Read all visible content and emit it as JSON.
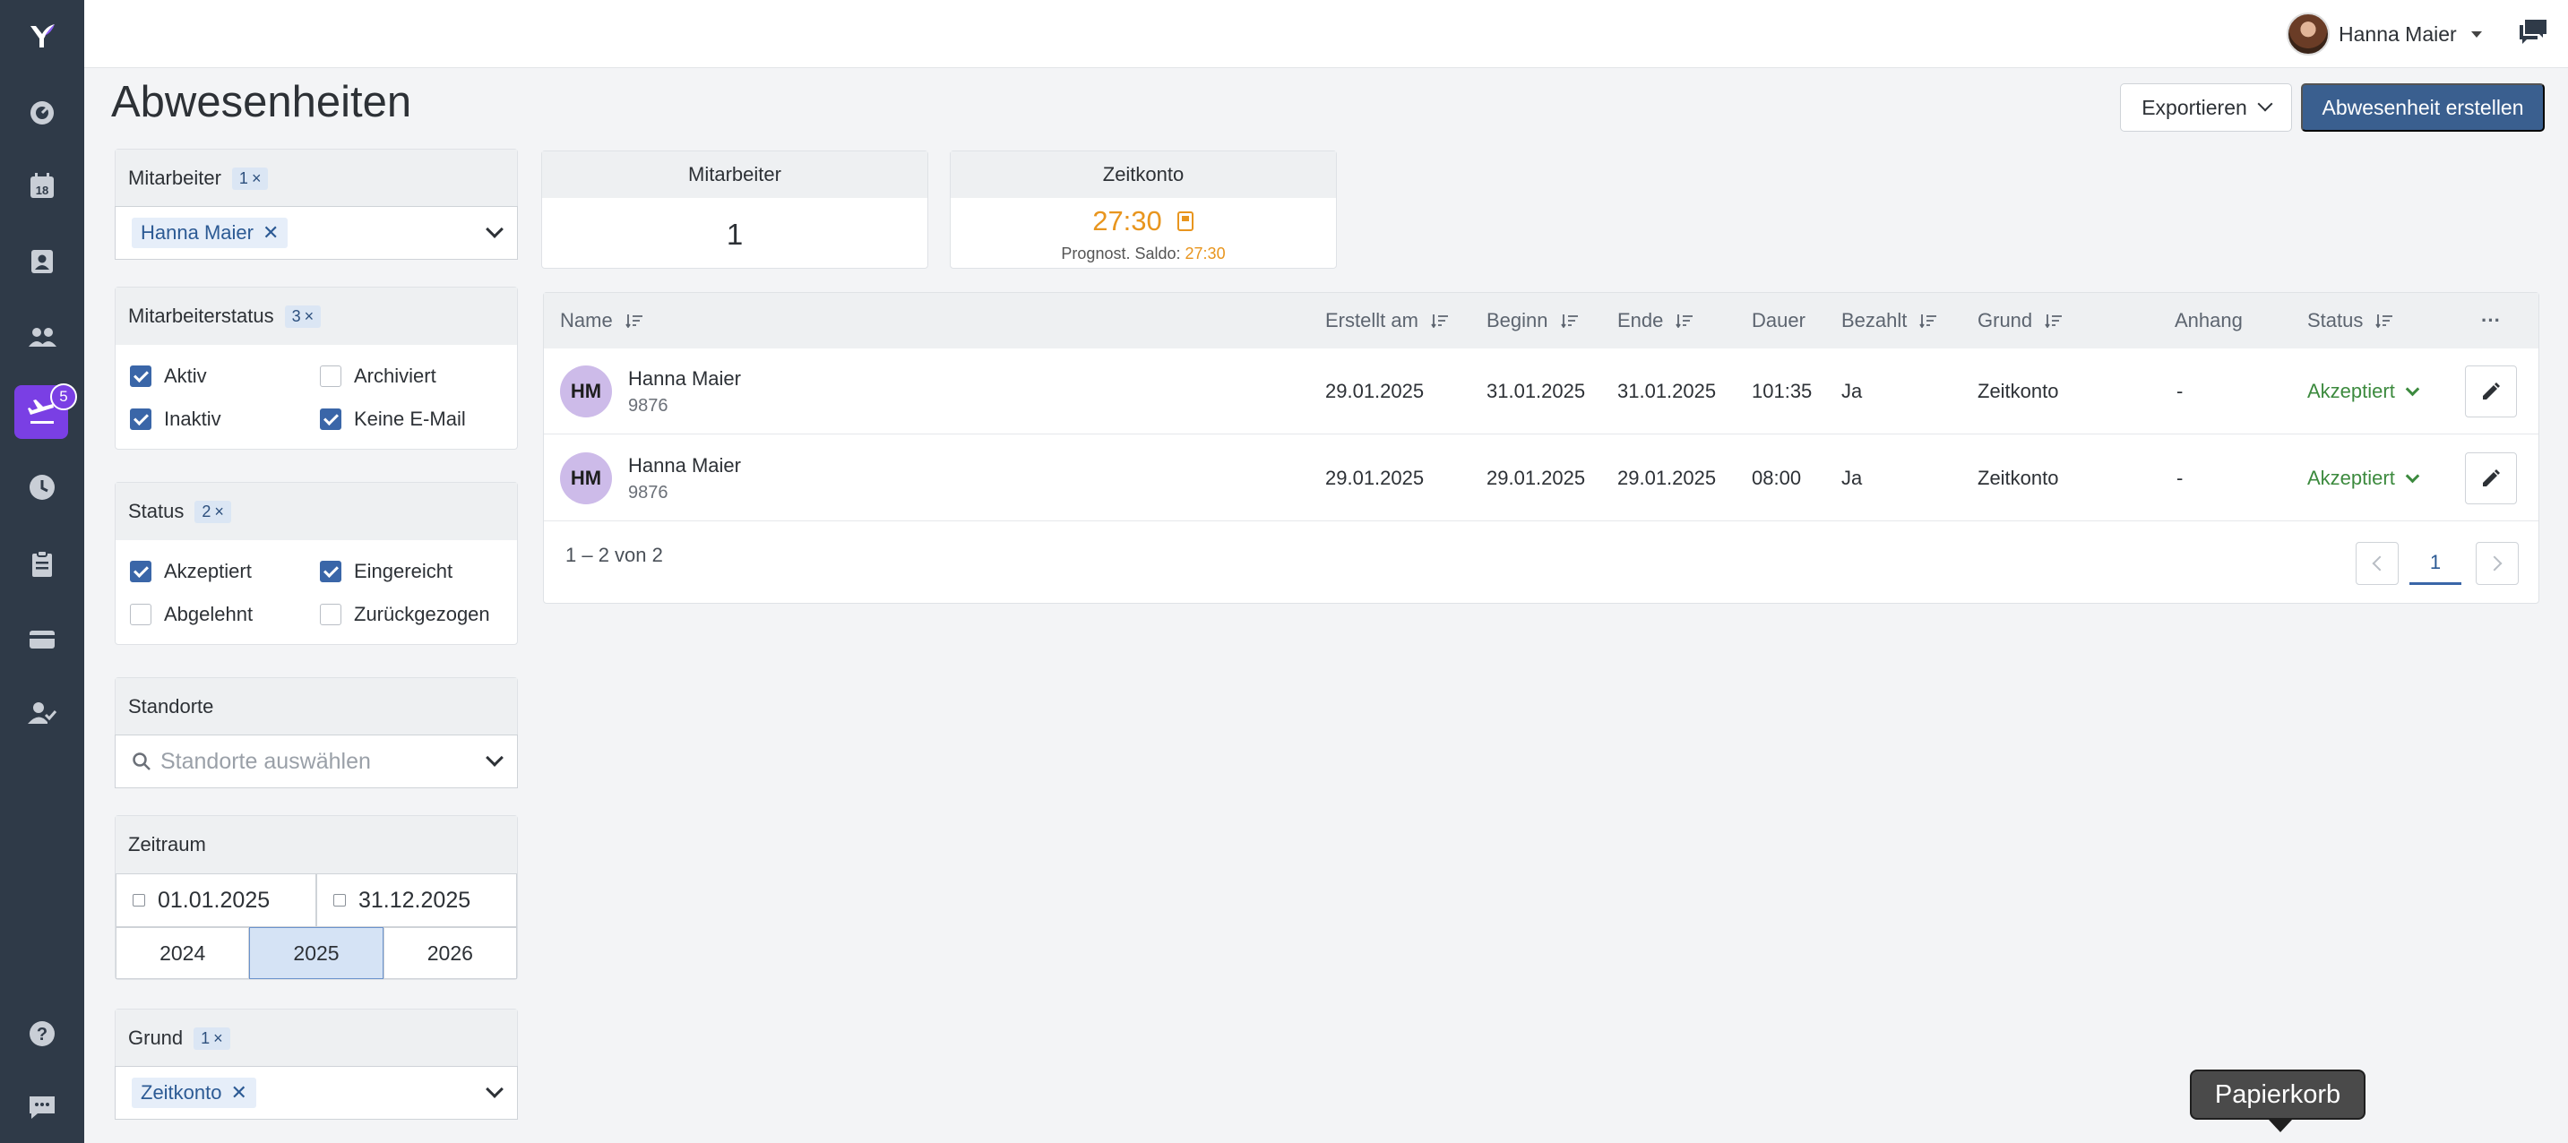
{
  "sidebar": {
    "badge_count": "5",
    "calendar_day": "18",
    "icons": [
      "logo-icon",
      "dashboard-icon",
      "calendar-icon",
      "contacts-icon",
      "team-icon",
      "absences-icon",
      "clock-icon",
      "clipboard-icon",
      "card-icon",
      "user-check-icon",
      "help-icon",
      "chat-icon"
    ]
  },
  "topbar": {
    "user_name": "Hanna Maier"
  },
  "page": {
    "title": "Abwesenheiten",
    "export_label": "Exportieren",
    "create_label": "Abwesenheit erstellen"
  },
  "filters": {
    "mitarbeiter": {
      "label": "Mitarbeiter",
      "count": "1",
      "selected": "Hanna Maier"
    },
    "mitarbeiterstatus": {
      "label": "Mitarbeiterstatus",
      "count": "3",
      "options": [
        {
          "label": "Aktiv",
          "checked": true
        },
        {
          "label": "Archiviert",
          "checked": false
        },
        {
          "label": "Inaktiv",
          "checked": true
        },
        {
          "label": "Keine E-Mail",
          "checked": true
        }
      ]
    },
    "status": {
      "label": "Status",
      "count": "2",
      "options": [
        {
          "label": "Akzeptiert",
          "checked": true
        },
        {
          "label": "Eingereicht",
          "checked": true
        },
        {
          "label": "Abgelehnt",
          "checked": false
        },
        {
          "label": "Zurückgezogen",
          "checked": false
        }
      ]
    },
    "standorte": {
      "label": "Standorte",
      "placeholder": "Standorte auswählen"
    },
    "zeitraum": {
      "label": "Zeitraum",
      "from": "01.01.2025",
      "to": "31.12.2025",
      "years": [
        "2024",
        "2025",
        "2026"
      ],
      "selected_year": "2025"
    },
    "grund": {
      "label": "Grund",
      "count": "1",
      "selected": "Zeitkonto"
    }
  },
  "summary": {
    "mitarbeiter": {
      "label": "Mitarbeiter",
      "value": "1"
    },
    "zeitkonto": {
      "label": "Zeitkonto",
      "value": "27:30",
      "sub_label": "Prognost. Saldo:",
      "sub_value": "27:30"
    }
  },
  "table": {
    "columns": {
      "name": "Name",
      "erstellt": "Erstellt am",
      "beginn": "Beginn",
      "ende": "Ende",
      "dauer": "Dauer",
      "bezahlt": "Bezahlt",
      "grund": "Grund",
      "anhang": "Anhang",
      "status": "Status",
      "more": "···"
    },
    "rows": [
      {
        "initials": "HM",
        "name": "Hanna Maier",
        "id": "9876",
        "erstellt": "29.01.2025",
        "beginn": "31.01.2025",
        "ende": "31.01.2025",
        "dauer": "101:35",
        "bezahlt": "Ja",
        "grund": "Zeitkonto",
        "anhang": "-",
        "status": "Akzeptiert"
      },
      {
        "initials": "HM",
        "name": "Hanna Maier",
        "id": "9876",
        "erstellt": "29.01.2025",
        "beginn": "29.01.2025",
        "ende": "29.01.2025",
        "dauer": "08:00",
        "bezahlt": "Ja",
        "grund": "Zeitkonto",
        "anhang": "-",
        "status": "Akzeptiert"
      }
    ],
    "pagination": {
      "summary": "1 – 2 von 2",
      "current_page": "1"
    }
  },
  "tooltip": {
    "text": "Papierkorb"
  },
  "colors": {
    "sidebar": "#2f3a48",
    "accent": "#7a3fe4",
    "primary": "#3a5f8f",
    "success": "#3c8a3e",
    "warning": "#e8951e"
  }
}
